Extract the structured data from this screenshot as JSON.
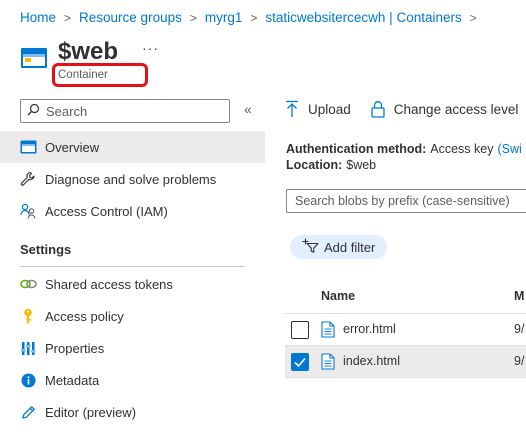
{
  "breadcrumb": [
    {
      "label": "Home"
    },
    {
      "label": "Resource groups"
    },
    {
      "label": "myrg1"
    },
    {
      "label": "staticwebsitercecwh | Containers"
    }
  ],
  "header": {
    "title": "$web",
    "subtitle": "Container",
    "more": "···"
  },
  "sidebar": {
    "search_placeholder": "Search",
    "collapse": "«",
    "items": [
      {
        "label": "Overview",
        "icon": "container-icon",
        "active": true
      },
      {
        "label": "Diagnose and solve problems",
        "icon": "wrench-icon"
      },
      {
        "label": "Access Control (IAM)",
        "icon": "people-icon"
      }
    ],
    "settings_title": "Settings",
    "settings_items": [
      {
        "label": "Shared access tokens",
        "icon": "link-icon"
      },
      {
        "label": "Access policy",
        "icon": "key-icon"
      },
      {
        "label": "Properties",
        "icon": "properties-icon"
      },
      {
        "label": "Metadata",
        "icon": "info-icon"
      },
      {
        "label": "Editor (preview)",
        "icon": "pencil-icon"
      }
    ]
  },
  "toolbar": {
    "upload": "Upload",
    "change_access": "Change access level"
  },
  "info": {
    "auth_label": "Authentication method:",
    "auth_value": "Access key",
    "auth_link": "(Swi",
    "location_label": "Location:",
    "location_value": "$web"
  },
  "blob_search": {
    "placeholder": "Search blobs by prefix (case-sensitive)"
  },
  "filter": {
    "label": "Add filter"
  },
  "table": {
    "col_name": "Name",
    "col_modified": "M",
    "rows": [
      {
        "name": "error.html",
        "modified": "9/",
        "checked": false
      },
      {
        "name": "index.html",
        "modified": "9/",
        "checked": true
      }
    ]
  },
  "colors": {
    "accent": "#0078d4",
    "highlight": "#e3101c",
    "selected_row": "#edebe9"
  }
}
